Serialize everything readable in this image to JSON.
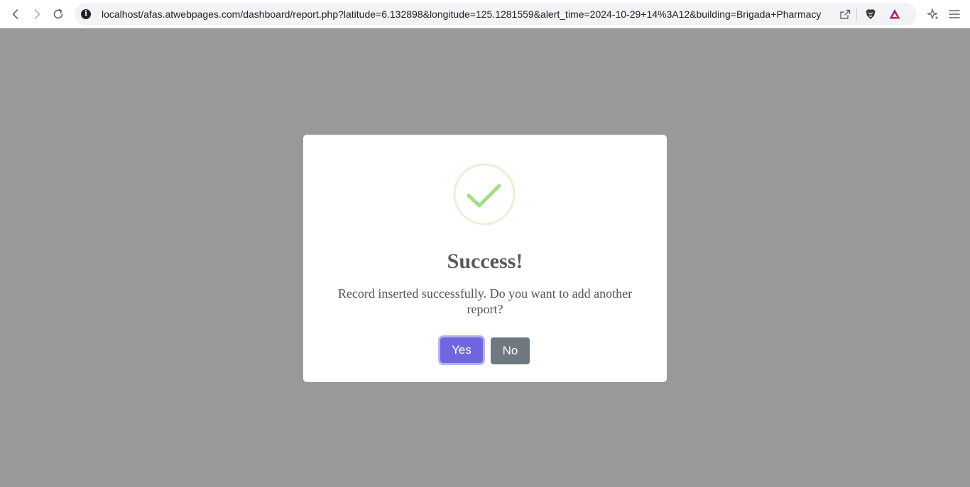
{
  "browser": {
    "url": "localhost/afas.atwebpages.com/dashboard/report.php?latitude=6.132898&longitude=125.1281559&alert_time=2024-10-29+14%3A12&building=Brigada+Pharmacy",
    "info_glyph": "i"
  },
  "dialog": {
    "title": "Success!",
    "message": "Record inserted successfully. Do you want to add another report?",
    "confirm_label": "Yes",
    "cancel_label": "No",
    "icon": "success-check-icon"
  },
  "colors": {
    "overlay": "#999999",
    "confirm_button": "#7066e0",
    "cancel_button": "#6e7881",
    "success_ring": "#e3f3d9",
    "success_check": "#a5dc86"
  }
}
